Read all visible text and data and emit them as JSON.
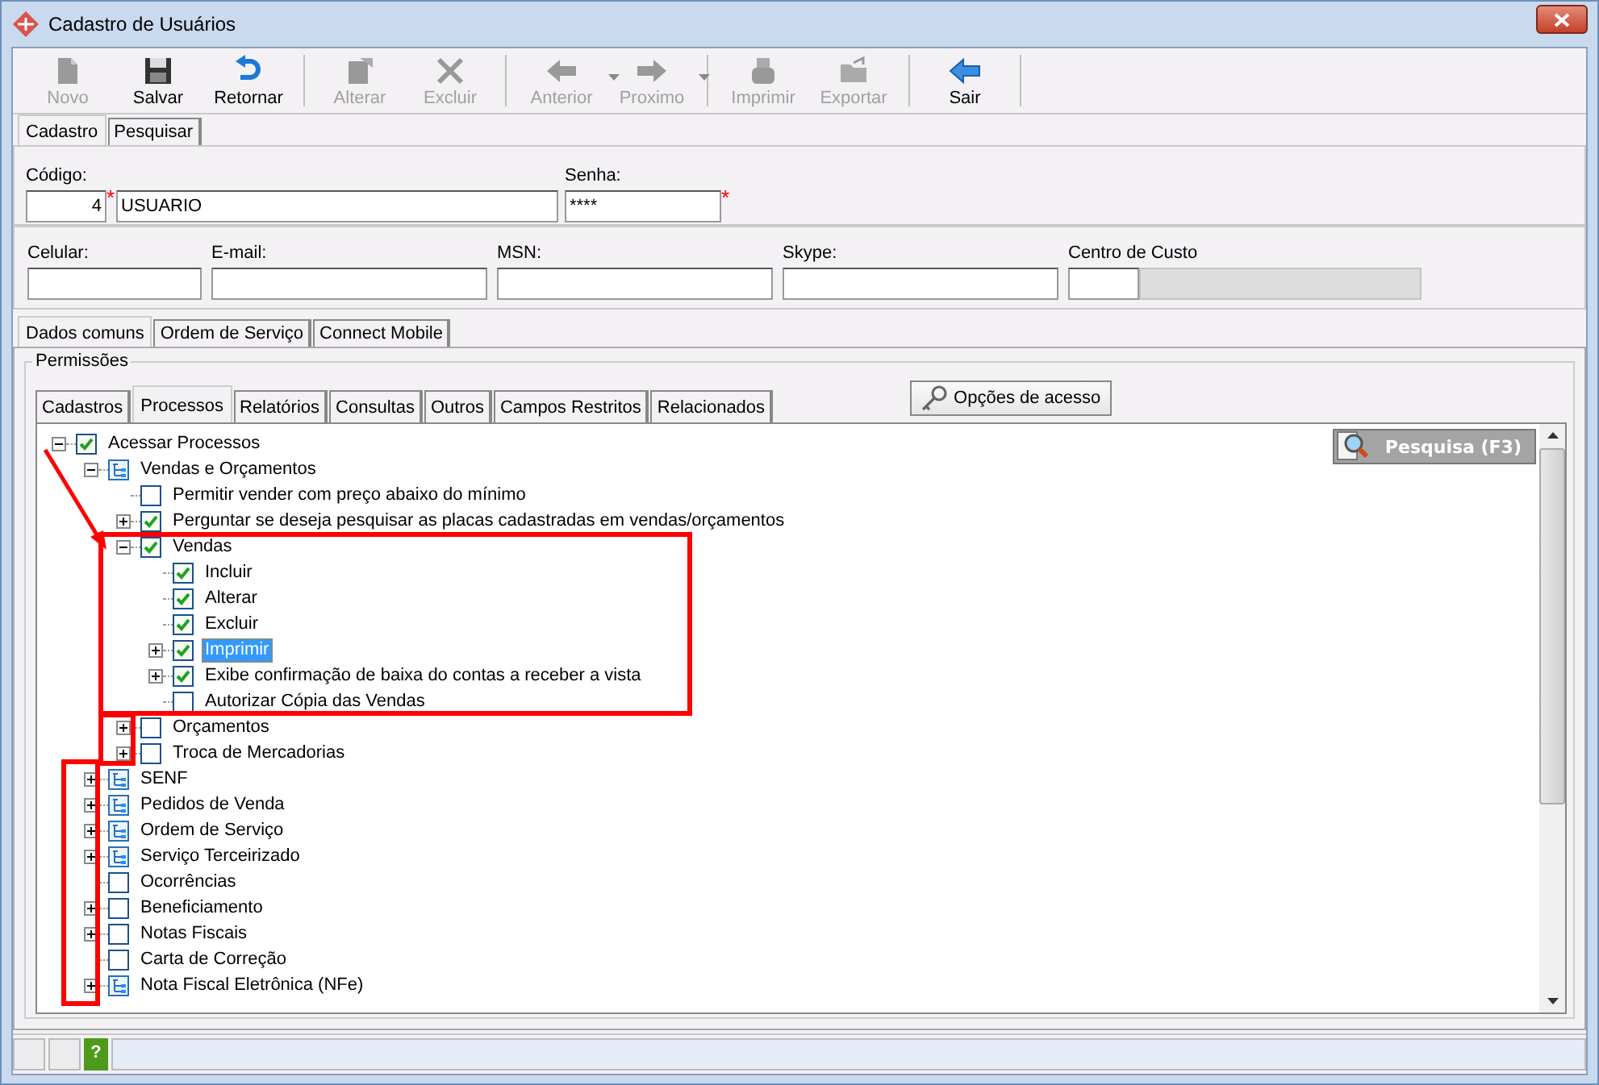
{
  "window": {
    "title": "Cadastro de Usuários"
  },
  "toolbar": [
    {
      "kind": "new",
      "label": "Novo",
      "disabled": true,
      "dropdown": false
    },
    {
      "kind": "save",
      "label": "Salvar",
      "disabled": false,
      "dropdown": false
    },
    {
      "kind": "undo",
      "label": "Retornar",
      "disabled": false,
      "dropdown": false
    },
    {
      "kind": "edit",
      "label": "Alterar",
      "disabled": true,
      "dropdown": false
    },
    {
      "kind": "delete",
      "label": "Excluir",
      "disabled": true,
      "dropdown": false
    },
    {
      "kind": "back",
      "label": "Anterior",
      "disabled": true,
      "dropdown": true
    },
    {
      "kind": "forward",
      "label": "Proximo",
      "disabled": true,
      "dropdown": true
    },
    {
      "kind": "print",
      "label": "Imprimir",
      "disabled": true,
      "dropdown": false
    },
    {
      "kind": "export",
      "label": "Exportar",
      "disabled": true,
      "dropdown": false
    },
    {
      "kind": "exit",
      "label": "Sair",
      "disabled": false,
      "dropdown": false
    }
  ],
  "main_tabs": [
    {
      "label": "Cadastro",
      "selected": true
    },
    {
      "label": "Pesquisar",
      "selected": false
    }
  ],
  "form": {
    "code_label": "Código:",
    "code_value": "4",
    "name_value": "USUARIO",
    "code_required_mark": "*",
    "password_label": "Senha:",
    "password_value": "****",
    "password_required_mark": "*"
  },
  "contact_fields": [
    {
      "label": "Celular:"
    },
    {
      "label": "E-mail:"
    },
    {
      "label": "MSN:"
    },
    {
      "label": "Skype:"
    }
  ],
  "cost_center": {
    "label": "Centro de Custo"
  },
  "sub_tabs": [
    {
      "label": "Dados comuns",
      "selected": true
    },
    {
      "label": "Ordem de Serviço",
      "selected": false
    },
    {
      "label": "Connect Mobile",
      "selected": false
    }
  ],
  "permissions": {
    "title": "Permissões",
    "tabs": [
      {
        "label": "Cadastros",
        "selected": false
      },
      {
        "label": "Processos",
        "selected": true
      },
      {
        "label": "Relatórios",
        "selected": false
      },
      {
        "label": "Consultas",
        "selected": false
      },
      {
        "label": "Outros",
        "selected": false
      },
      {
        "label": "Campos Restritos",
        "selected": false
      },
      {
        "label": "Relacionados",
        "selected": false
      }
    ],
    "access_button": "Opções de acesso",
    "search_button": "Pesquisa (F3)",
    "tree": [
      {
        "kind": "check",
        "label": "Acessar Processos",
        "checked": true,
        "expanded": true,
        "selected": false,
        "children": [
          {
            "kind": "group",
            "label": "Vendas e Orçamentos",
            "expanded": true,
            "selected": false,
            "children": [
              {
                "kind": "check",
                "label": "Permitir vender com preço abaixo do mínimo",
                "checked": false,
                "selected": false
              },
              {
                "kind": "check",
                "label": "Perguntar se deseja pesquisar as placas cadastradas em vendas/orçamentos",
                "checked": true,
                "expanded": false,
                "selected": false
              },
              {
                "kind": "check",
                "label": "Vendas",
                "checked": true,
                "expanded": true,
                "selected": false,
                "children": [
                  {
                    "kind": "check",
                    "label": "Incluir",
                    "checked": true,
                    "selected": false
                  },
                  {
                    "kind": "check",
                    "label": "Alterar",
                    "checked": true,
                    "selected": false
                  },
                  {
                    "kind": "check",
                    "label": "Excluir",
                    "checked": true,
                    "selected": false
                  },
                  {
                    "kind": "check",
                    "label": "Imprimir",
                    "checked": true,
                    "expanded": false,
                    "selected": true
                  },
                  {
                    "kind": "check",
                    "label": "Exibe confirmação de baixa do contas a receber a vista",
                    "checked": true,
                    "expanded": false,
                    "selected": false
                  },
                  {
                    "kind": "check",
                    "label": "Autorizar Cópia das Vendas",
                    "checked": false,
                    "selected": false
                  }
                ]
              },
              {
                "kind": "check",
                "label": "Orçamentos",
                "checked": false,
                "expanded": false,
                "selected": false
              },
              {
                "kind": "check",
                "label": "Troca de Mercadorias",
                "checked": false,
                "expanded": false,
                "selected": false
              }
            ]
          },
          {
            "kind": "group",
            "label": "SENF",
            "expanded": false,
            "selected": false
          },
          {
            "kind": "group",
            "label": "Pedidos de Venda",
            "expanded": false,
            "selected": false
          },
          {
            "kind": "group",
            "label": "Ordem de Serviço",
            "expanded": false,
            "selected": false
          },
          {
            "kind": "group",
            "label": "Serviço Terceirizado",
            "expanded": false,
            "selected": false
          },
          {
            "kind": "check",
            "label": "Ocorrências",
            "checked": false,
            "selected": false
          },
          {
            "kind": "check",
            "label": "Beneficiamento",
            "checked": false,
            "expanded": false,
            "selected": false
          },
          {
            "kind": "check",
            "label": "Notas Fiscais",
            "checked": false,
            "expanded": false,
            "selected": false
          },
          {
            "kind": "check",
            "label": "Carta de Correção",
            "checked": false,
            "selected": false
          },
          {
            "kind": "group",
            "label": "Nota Fiscal Eletrônica (NFe)",
            "expanded": false,
            "selected": false
          }
        ]
      }
    ]
  },
  "status_bar": {
    "help": "?"
  }
}
